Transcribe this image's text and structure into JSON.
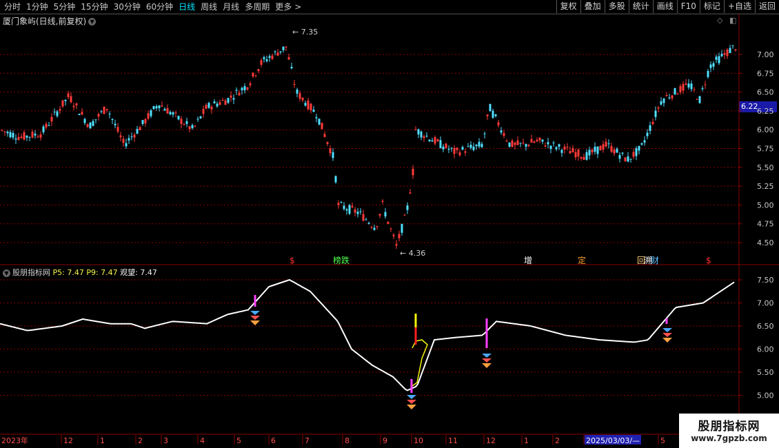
{
  "toolbar": {
    "periods": [
      "分时",
      "1分钟",
      "5分钟",
      "15分钟",
      "30分钟",
      "60分钟",
      "日线",
      "周线",
      "月线",
      "多周期",
      "更多"
    ],
    "active_period": "日线",
    "more_arrow": ">",
    "right_buttons": [
      "复权",
      "叠加",
      "多股",
      "统计",
      "画线",
      "F10",
      "标记",
      "+自选",
      "返回"
    ]
  },
  "stock": {
    "title": "厦门象屿(日线,前复权)",
    "last_price_tag": "6.22"
  },
  "main_chart": {
    "y_ticks": [
      "7.00",
      "6.75",
      "6.50",
      "6.25",
      "6.00",
      "5.75",
      "5.50",
      "5.25",
      "5.00",
      "4.75",
      "4.50"
    ],
    "high_label": "7.35",
    "low_label": "4.36",
    "markers": [
      {
        "text": "$",
        "color": "#ff3030"
      },
      {
        "text": "榜跌",
        "color": "#50ff50"
      },
      {
        "text": "增",
        "color": "#ffffff"
      },
      {
        "text": "定",
        "color": "#ffa030"
      },
      {
        "text": "回",
        "color": "#ffd080"
      },
      {
        "text": "溯",
        "color": "#ffffff"
      },
      {
        "text": "财",
        "color": "#60c0ff"
      },
      {
        "text": "$",
        "color": "#ff3030"
      }
    ]
  },
  "indicator": {
    "name": "股朋指标网",
    "p5_label": "P5: 7.47",
    "p9_label": "P9: 7.47",
    "watch_label": "观望: 7.47",
    "y_ticks": [
      "7.50",
      "7.00",
      "6.50",
      "6.00",
      "5.50",
      "5.00"
    ]
  },
  "x_axis": {
    "labels": [
      "2023年",
      "12",
      "1",
      "2",
      "3",
      "4",
      "5",
      "6",
      "7",
      "8",
      "9",
      "10",
      "11",
      "12",
      "1",
      "2",
      "2025/03/03/—",
      "5"
    ]
  },
  "watermark": {
    "line1": "股朋指标网",
    "line2": "www.7gpzb.com"
  },
  "colors": {
    "up": "#ff3a3a",
    "down": "#50e0ff",
    "grid": "#8b0000",
    "line": "#ffffff"
  }
}
